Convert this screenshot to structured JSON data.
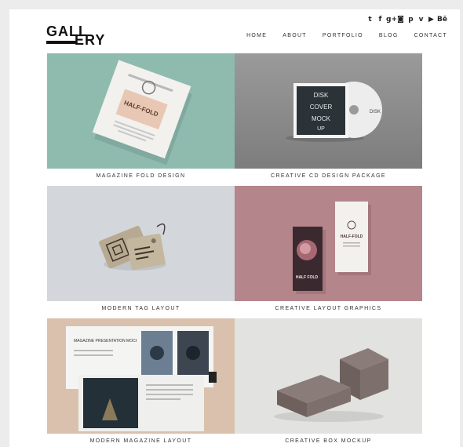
{
  "logo": {
    "part1": "GALL",
    "part2": "ERY"
  },
  "social": [
    {
      "name": "twitter-icon",
      "glyph": "t"
    },
    {
      "name": "facebook-icon",
      "glyph": "f"
    },
    {
      "name": "google-plus-icon",
      "glyph": "g+"
    },
    {
      "name": "instagram-icon",
      "glyph": "◙"
    },
    {
      "name": "pinterest-icon",
      "glyph": "p"
    },
    {
      "name": "vimeo-icon",
      "glyph": "v"
    },
    {
      "name": "youtube-icon",
      "glyph": "▶"
    },
    {
      "name": "behance-icon",
      "glyph": "Bē"
    }
  ],
  "nav": [
    "HOME",
    "ABOUT",
    "PORTFOLIO",
    "BLOG",
    "CONTACT"
  ],
  "items": [
    {
      "caption": "MAGAZINE FOLD DESIGN",
      "bg": "#8fbbaf",
      "thumb_texts": [
        "HALF-FOLD"
      ]
    },
    {
      "caption": "CREATIVE CD DESIGN PACKAGE",
      "bg": "#8e8e8e",
      "thumb_texts": [
        "DISK",
        "COVER",
        "MOCK",
        "UP",
        "DISK"
      ]
    },
    {
      "caption": "MODERN TAG LAYOUT",
      "bg": "#d3d6da",
      "thumb_texts": []
    },
    {
      "caption": "CREATIVE LAYOUT GRAPHICS",
      "bg": "#b4858a",
      "thumb_texts": [
        "HALF-FOLD",
        "HALF FOLD"
      ]
    },
    {
      "caption": "MODERN MAGAZINE LAYOUT",
      "bg": "#d9c1ad",
      "thumb_texts": [
        "MAGAZINE PRESENTATION MOCK UP VOL. 02"
      ]
    },
    {
      "caption": "CREATIVE BOX MOCKUP",
      "bg": "#e2e2e0",
      "thumb_texts": []
    }
  ]
}
